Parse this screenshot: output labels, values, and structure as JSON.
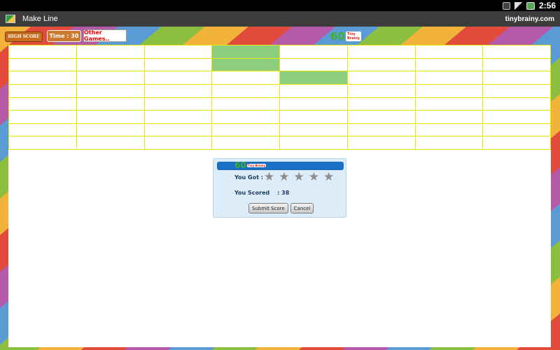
{
  "statusbar": {
    "time": "2:56",
    "icons": [
      "usb-icon",
      "signal-icon",
      "battery-icon"
    ]
  },
  "titlebar": {
    "app_title": "Make Line",
    "site": "tinybrainy.com"
  },
  "toolbar": {
    "high_score_label": "HIGH SCORE",
    "time_label": "Time : 30",
    "other_games_label": "Other Games..",
    "logo_number": "60",
    "logo_text": "Tiny Brainy"
  },
  "grid": {
    "rows": 8,
    "columns": 8,
    "filled_cells": [
      [
        0,
        3
      ],
      [
        1,
        3
      ],
      [
        2,
        4
      ]
    ]
  },
  "dialog": {
    "logo_number": "60",
    "logo_text": "Tiny Brainy",
    "you_got_label": "You Got :",
    "stars": [
      "★",
      "★",
      "★",
      "★",
      "★"
    ],
    "scored_label": "You Scored",
    "scored_value": ": 38",
    "submit_label": "Submit Score",
    "cancel_label": "Cancel"
  },
  "colors": {
    "grid_line": "#e6e600",
    "filled_cell": "#8ccd7e",
    "dialog_bg": "#dcecf8",
    "dialog_header": "#1a6fc4",
    "star_empty": "#8c8c8c"
  }
}
